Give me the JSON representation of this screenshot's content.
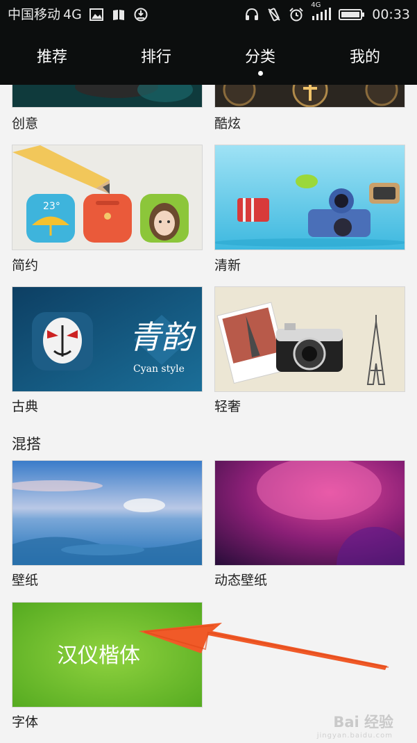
{
  "status_bar": {
    "carrier": "中国移动",
    "network": "4G",
    "network_small": "4G",
    "time": "00:33"
  },
  "tabs": [
    {
      "label": "推荐"
    },
    {
      "label": "排行"
    },
    {
      "label": "分类",
      "active": true
    },
    {
      "label": "我的"
    }
  ],
  "categories": {
    "items": [
      {
        "label": "创意"
      },
      {
        "label": "酷炫"
      },
      {
        "label": "简约"
      },
      {
        "label": "清新"
      },
      {
        "label": "古典"
      },
      {
        "label": "轻奢"
      }
    ],
    "thumb_texts": {
      "qingyun": "青韵",
      "cyan_style": "Cyan style",
      "weather_temp": "23°"
    }
  },
  "mixed": {
    "title": "混搭",
    "items": [
      {
        "label": "壁纸"
      },
      {
        "label": "动态壁纸"
      },
      {
        "label": "字体",
        "thumb_text": "汉仪楷体"
      }
    ]
  },
  "watermark": {
    "brand": "Bai 经验",
    "url": "jingyan.baidu.com"
  },
  "colors": {
    "bar_bg": "#0c0e0e",
    "arrow": "#f05a28",
    "font_thumb_green": "#6fc22b"
  },
  "icons": [
    "picture-icon",
    "book-icon",
    "shield-icon",
    "headphones-icon",
    "vibrate-icon",
    "alarm-icon",
    "signal-icon",
    "battery-icon"
  ]
}
